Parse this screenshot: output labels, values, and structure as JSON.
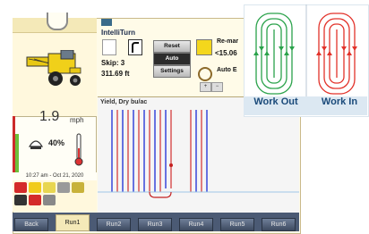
{
  "left": {
    "speed_value": "1.9",
    "speed_unit": "mph",
    "load_percent": "40%",
    "datetime": "10:27 am - Oct 21, 2020"
  },
  "intelliturn": {
    "title": "IntelliTurn",
    "skip": "Skip: 3",
    "distance": "311.69 ft",
    "reset_label": "Reset",
    "auto_label": "Auto",
    "settings_label": "Settings",
    "remark_label": "Re-mar",
    "remark_value": "<15.06",
    "auto_end_label": "Auto E"
  },
  "map": {
    "header": "Yield, Dry bu/ac",
    "zoom_in": "+",
    "zoom_out": "−"
  },
  "tabs": [
    "Back",
    "Run1",
    "Run2",
    "Run3",
    "Run4",
    "Run5",
    "Run6"
  ],
  "selected_tab": "Run1",
  "inset": {
    "work_out_label": "Work Out",
    "work_in_label": "Work In",
    "work_out_color": "#2aa24a",
    "work_in_color": "#e2322a"
  }
}
